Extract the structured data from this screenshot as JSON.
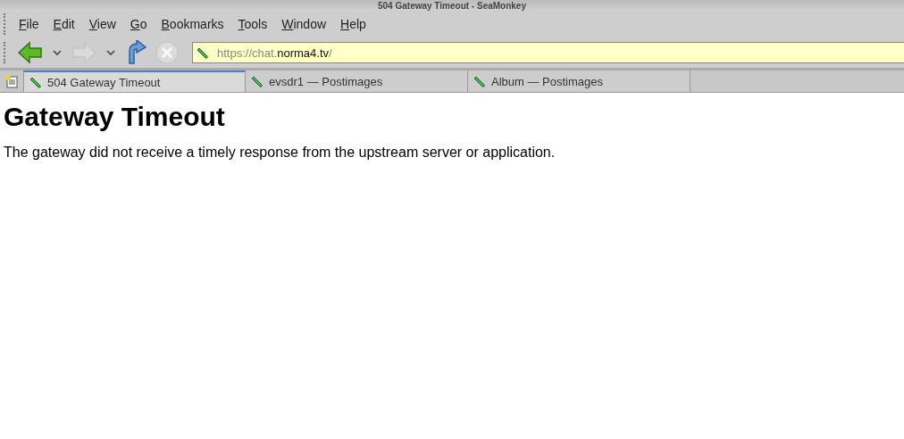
{
  "window": {
    "title": "504 Gateway Timeout - SeaMonkey"
  },
  "menu": [
    "File",
    "Edit",
    "View",
    "Go",
    "Bookmarks",
    "Tools",
    "Window",
    "Help"
  ],
  "toolbar": [
    {
      "kind": "back",
      "disabled": false,
      "dropdown": true
    },
    {
      "kind": "forward",
      "disabled": true,
      "dropdown": true
    },
    {
      "kind": "reload",
      "disabled": false,
      "dropdown": false
    },
    {
      "kind": "stop",
      "disabled": true,
      "dropdown": false
    }
  ],
  "address": {
    "prefix": "https://chat.",
    "domain": "norma4.tv",
    "suffix": "/"
  },
  "tabs": [
    {
      "label": "504 Gateway Timeout",
      "selected": true
    },
    {
      "label": "evsdr1 — Postimages",
      "selected": false
    },
    {
      "label": "Album — Postimages",
      "selected": false
    }
  ],
  "page": {
    "heading": "Gateway Timeout",
    "message": "The gateway did not receive a timely response from the upstream server or application."
  }
}
